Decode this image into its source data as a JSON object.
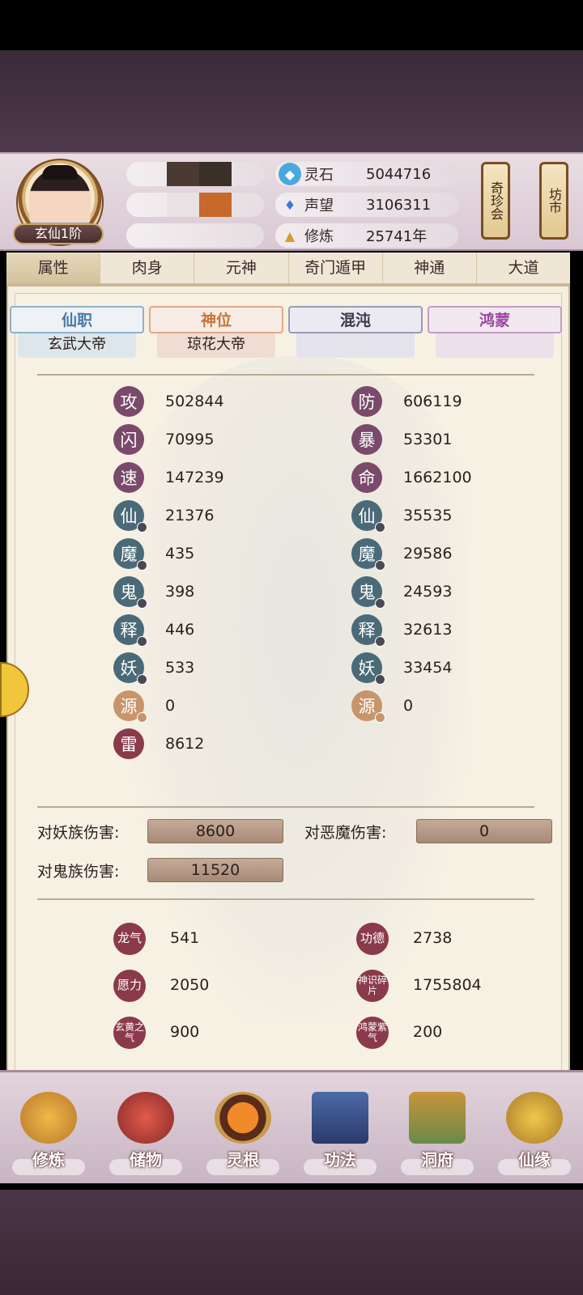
{
  "player": {
    "rank": "玄仙1阶"
  },
  "resources": [
    {
      "label": "灵石",
      "value": "5044716",
      "icon": "spirit-stone-icon"
    },
    {
      "label": "声望",
      "value": "3106311",
      "icon": "prestige-icon"
    },
    {
      "label": "修炼",
      "value": "25741年",
      "icon": "cultivation-icon"
    }
  ],
  "side_buttons": [
    {
      "label": "奇珍会"
    },
    {
      "label": "坊市"
    }
  ],
  "tabs": [
    "属性",
    "肉身",
    "元神",
    "奇门遁甲",
    "神通",
    "大道"
  ],
  "active_tab": "属性",
  "titles": [
    {
      "head": "仙职",
      "body": "玄武大帝",
      "color": "#4a7aa8"
    },
    {
      "head": "神位",
      "body": "琼花大帝",
      "color": "#c8743a"
    },
    {
      "head": "混沌",
      "body": "",
      "color": "#3a3a4a"
    },
    {
      "head": "鸿蒙",
      "body": "",
      "color": "#9a4aa0"
    }
  ],
  "stats_left": [
    {
      "icon": "攻",
      "value": "502844"
    },
    {
      "icon": "闪",
      "value": "70995"
    },
    {
      "icon": "速",
      "value": "147239"
    },
    {
      "icon": "仙",
      "value": "21376"
    },
    {
      "icon": "魔",
      "value": "435"
    },
    {
      "icon": "鬼",
      "value": "398"
    },
    {
      "icon": "释",
      "value": "446"
    },
    {
      "icon": "妖",
      "value": "533"
    },
    {
      "icon": "源",
      "value": "0"
    },
    {
      "icon": "雷",
      "value": "8612"
    }
  ],
  "stats_right": [
    {
      "icon": "防",
      "value": "606119"
    },
    {
      "icon": "暴",
      "value": "53301"
    },
    {
      "icon": "命",
      "value": "1662100"
    },
    {
      "icon": "仙",
      "value": "35535"
    },
    {
      "icon": "魔",
      "value": "29586"
    },
    {
      "icon": "鬼",
      "value": "24593"
    },
    {
      "icon": "释",
      "value": "32613"
    },
    {
      "icon": "妖",
      "value": "33454"
    },
    {
      "icon": "源",
      "value": "0"
    }
  ],
  "damage": [
    {
      "label": "对妖族伤害:",
      "value": "8600"
    },
    {
      "label": "对恶魔伤害:",
      "value": "0"
    },
    {
      "label": "对鬼族伤害:",
      "value": "11520"
    }
  ],
  "misc": [
    {
      "icon": "龙气",
      "value": "541"
    },
    {
      "icon": "功德",
      "value": "2738"
    },
    {
      "icon": "愿力",
      "value": "2050"
    },
    {
      "icon": "神识碎片",
      "value": "1755804"
    },
    {
      "icon": "玄黄之气",
      "value": "900"
    },
    {
      "icon": "鸿蒙紫气",
      "value": "200"
    }
  ],
  "nav": [
    "修炼",
    "储物",
    "灵根",
    "功法",
    "洞府",
    "仙缘"
  ]
}
